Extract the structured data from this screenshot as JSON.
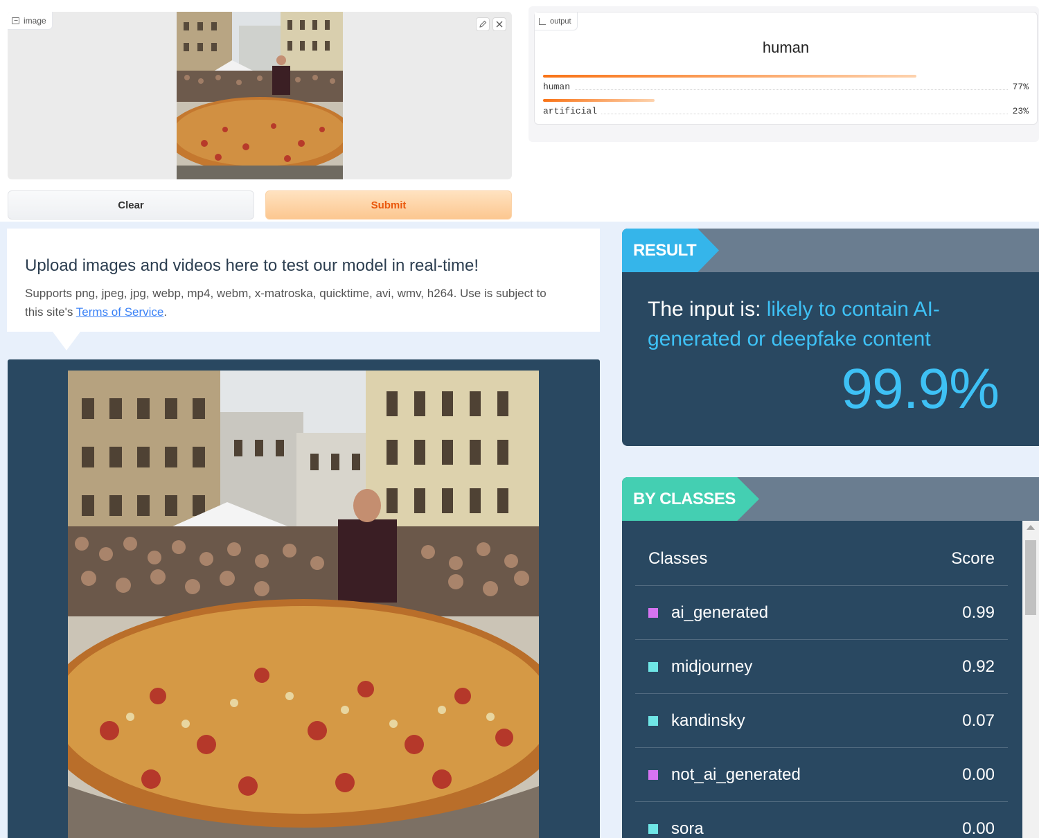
{
  "input_panel": {
    "label": "image",
    "edit_icon": "pencil-icon",
    "close_icon": "close-icon",
    "clear_label": "Clear",
    "submit_label": "Submit"
  },
  "output_panel": {
    "label": "output",
    "top_label": "human",
    "confidences": [
      {
        "label": "human",
        "value": "77%",
        "fraction": 0.77
      },
      {
        "label": "artificial",
        "value": "23%",
        "fraction": 0.23
      }
    ]
  },
  "upload_info": {
    "heading": "Upload images and videos here to test our model in real-time!",
    "supports_text": "Supports png, jpeg, jpg, webp, mp4, webm, x-matroska, quicktime, avi, wmv, h264. Use is subject to this site's ",
    "terms_link": "Terms of Service",
    "trailing": "."
  },
  "result": {
    "tab_label": "RESULT",
    "prefix": "The input is: ",
    "verdict": "likely to contain AI-generated or deepfake content",
    "percentage": "99.9%"
  },
  "by_classes": {
    "tab_label": "BY CLASSES",
    "col_classes": "Classes",
    "col_score": "Score",
    "rows": [
      {
        "name": "ai_generated",
        "score": "0.99",
        "color": "#d674f1"
      },
      {
        "name": "midjourney",
        "score": "0.92",
        "color": "#6fe6e6"
      },
      {
        "name": "kandinsky",
        "score": "0.07",
        "color": "#6fe6e6"
      },
      {
        "name": "not_ai_generated",
        "score": "0.00",
        "color": "#d674f1"
      },
      {
        "name": "sora",
        "score": "0.00",
        "color": "#6fe6e6"
      }
    ]
  },
  "colors": {
    "accent_orange": "#f97316",
    "panel_navy": "#294861",
    "result_blue": "#3ec1f5",
    "classes_teal": "#44cfb2"
  }
}
